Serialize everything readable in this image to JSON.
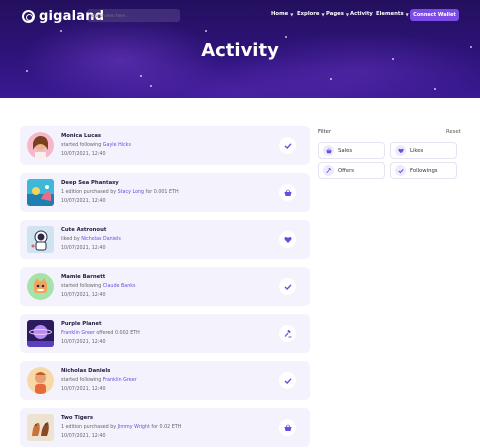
{
  "app": {
    "name": "gigaland"
  },
  "search": {
    "placeholder": "search item here..."
  },
  "nav": {
    "items": [
      {
        "label": "Home",
        "dropdown": true
      },
      {
        "label": "Explore",
        "dropdown": true
      },
      {
        "label": "Pages",
        "dropdown": true
      },
      {
        "label": "Activity",
        "dropdown": false
      },
      {
        "label": "Elements",
        "dropdown": true
      }
    ],
    "cta_label": "Connect Wallet"
  },
  "hero": {
    "title": "Activity"
  },
  "colors": {
    "accent": "#7b4be6",
    "link": "#6c4ce0",
    "card_bg": "#f4f2fc",
    "hero_dark": "#24105e"
  },
  "activity": [
    {
      "title": "Monica Lucas",
      "desc_before": "started following ",
      "desc_link": "Gayle Hicks",
      "desc_after": "",
      "date": "10/07/2021, 12:40",
      "icon": "check-icon"
    },
    {
      "title": "Deep Sea Phantasy",
      "desc_before": "1 edition purchased by ",
      "desc_link": "Stacy Long",
      "desc_after": " for 0.001 ETH",
      "date": "10/07/2021, 12:40",
      "icon": "basket-icon"
    },
    {
      "title": "Cute Astronout",
      "desc_before": "liked by ",
      "desc_link": "Nicholas Daniels",
      "desc_after": "",
      "date": "10/07/2021, 12:40",
      "icon": "heart-icon"
    },
    {
      "title": "Mamie Barnett",
      "desc_before": "started following ",
      "desc_link": "Claude Banks",
      "desc_after": "",
      "date": "10/07/2021, 12:40",
      "icon": "check-icon"
    },
    {
      "title": "Purple Planet",
      "desc_before": "",
      "desc_link": "Franklin Greer",
      "desc_after": " offered 0.002 ETH",
      "date": "10/07/2021, 12:40",
      "icon": "gavel-icon"
    },
    {
      "title": "Nicholas Daniels",
      "desc_before": "started following ",
      "desc_link": "Franklin Greer",
      "desc_after": "",
      "date": "10/07/2021, 12:40",
      "icon": "check-icon"
    },
    {
      "title": "Two Tigers",
      "desc_before": "1 edition purchased by ",
      "desc_link": "Jimmy Wright",
      "desc_after": " for 0.02 ETH",
      "date": "10/07/2021, 12:40",
      "icon": "basket-icon"
    }
  ],
  "filter": {
    "heading": "Filter",
    "reset_label": "Reset",
    "chips": [
      {
        "label": "Sales",
        "icon": "basket-icon"
      },
      {
        "label": "Likes",
        "icon": "heart-icon"
      },
      {
        "label": "Offers",
        "icon": "gavel-icon"
      },
      {
        "label": "Followings",
        "icon": "check-icon"
      }
    ]
  }
}
